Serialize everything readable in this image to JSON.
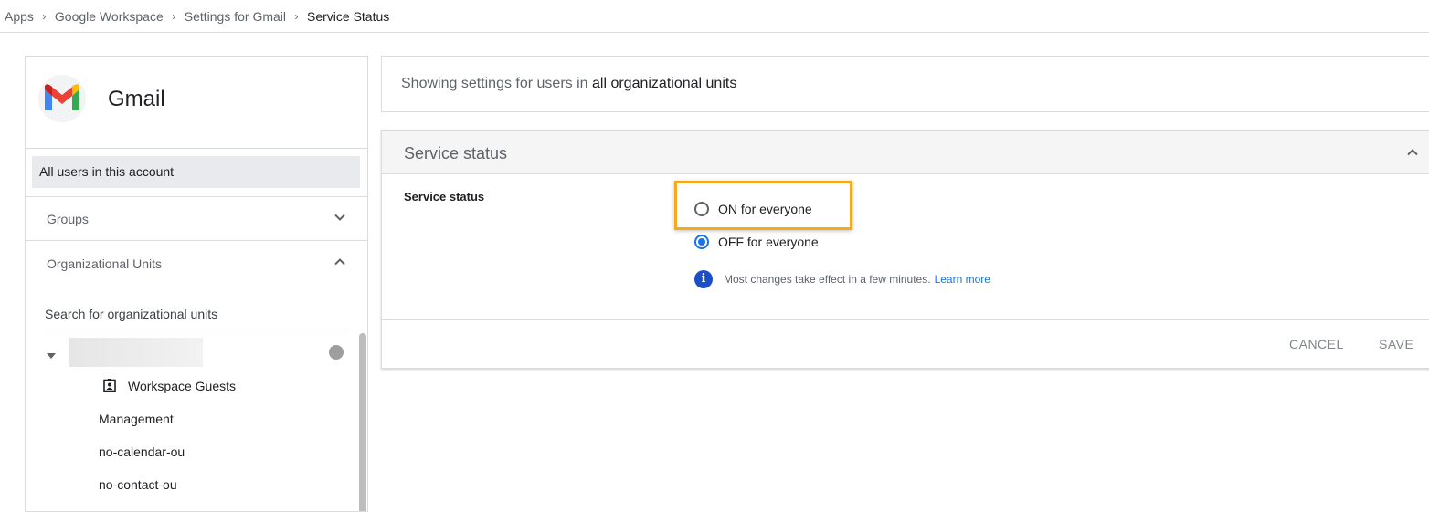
{
  "breadcrumb": {
    "items": [
      "Apps",
      "Google Workspace",
      "Settings for Gmail"
    ],
    "current": "Service Status",
    "separator": "›"
  },
  "app": {
    "name": "Gmail",
    "logo_icon": "gmail-logo-icon"
  },
  "sidebar": {
    "all_users": "All users in this account",
    "groups_label": "Groups",
    "org_units_label": "Organizational Units",
    "search_placeholder": "Search for organizational units",
    "tree": {
      "guests": "Workspace Guests",
      "children": [
        "Management",
        "no-calendar-ou",
        "no-contact-ou"
      ]
    }
  },
  "ou_info": {
    "prefix": "Showing settings for users in",
    "target": "all organizational units"
  },
  "service_card": {
    "title": "Service status",
    "setting_label": "Service status",
    "options": [
      {
        "label": "ON for everyone",
        "selected": false
      },
      {
        "label": "OFF for everyone",
        "selected": true
      }
    ],
    "info_text": "Most changes take effect in a few minutes.",
    "learn_more": "Learn more",
    "cancel_label": "CANCEL",
    "save_label": "SAVE"
  },
  "colors": {
    "accent": "#1a73e8",
    "highlight": "#f4a91f",
    "info_icon": "#1a4fc7"
  }
}
